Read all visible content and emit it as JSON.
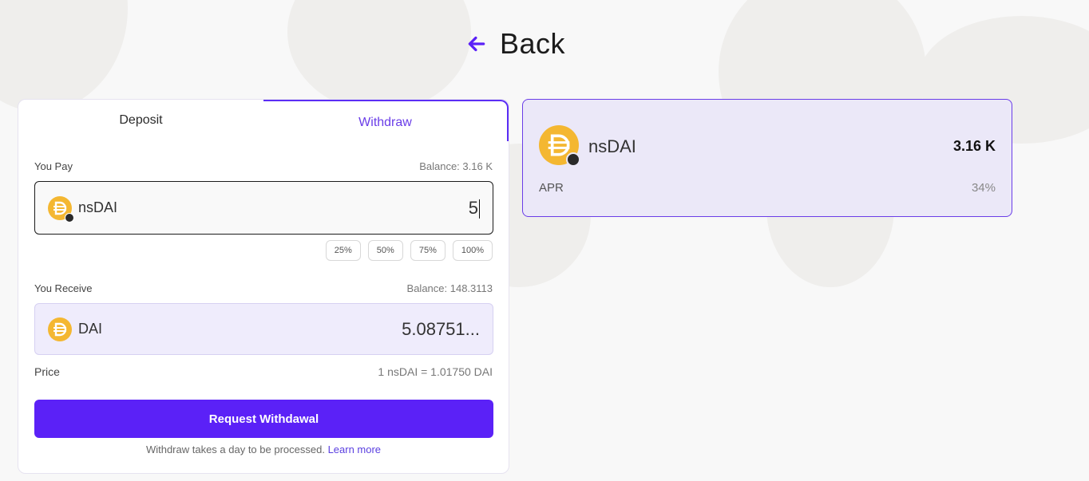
{
  "back": {
    "label": "Back",
    "icon": "arrow-left-icon"
  },
  "tabs": [
    {
      "label": "Deposit",
      "active": false
    },
    {
      "label": "Withdraw",
      "active": true
    }
  ],
  "pay": {
    "label": "You Pay",
    "balance": "Balance: 3.16 K",
    "token": "nsDAI",
    "amount": "5",
    "percent_buttons": [
      "25%",
      "50%",
      "75%",
      "100%"
    ]
  },
  "receive": {
    "label": "You Receive",
    "balance": "Balance: 148.3113",
    "token": "DAI",
    "amount": "5.08751..."
  },
  "price": {
    "label": "Price",
    "value": "1 nsDAI = 1.01750 DAI"
  },
  "cta": {
    "label": "Request Withdawal"
  },
  "note": {
    "text": "Withdraw takes a day to be processed. ",
    "link": "Learn more"
  },
  "info": {
    "symbol": "nsDAI",
    "balance": "3.16 K",
    "apr_label": "APR",
    "apr_value": "34%"
  },
  "colors": {
    "accent": "#5b21f7",
    "coin": "#f4b731",
    "info_bg": "#ebe8f8",
    "receive_bg": "#efecfc"
  }
}
